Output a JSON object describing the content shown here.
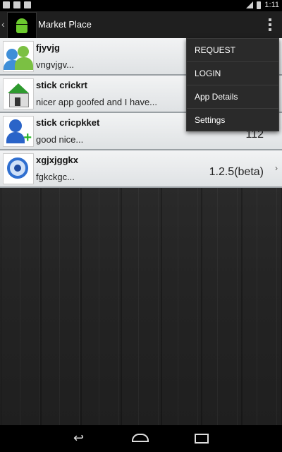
{
  "status_bar": {
    "time": "1:11"
  },
  "action_bar": {
    "title": "Market Place",
    "up_icon": "chevron-left-icon",
    "app_icon": "android-icon",
    "overflow_icon": "overflow-menu-icon"
  },
  "list": {
    "items": [
      {
        "name": "fjyvjg",
        "description": "vngvjgv...",
        "version": "",
        "icon": "users-icon"
      },
      {
        "name": "stick crickrt",
        "description": "nicer app goofed and I have...",
        "version": "",
        "icon": "house-icon"
      },
      {
        "name": "stick cricpkket",
        "description": "good nice...",
        "version": "112",
        "icon": "add-user-icon"
      },
      {
        "name": "xgjxjggkx",
        "description": "fgkckgc...",
        "version": "1.2.5(beta)",
        "icon": "sync-icon"
      }
    ]
  },
  "menu": {
    "items": [
      "REQUEST",
      "LOGIN",
      "App Details",
      "Settings"
    ]
  },
  "nav_bar": {
    "back_icon": "back-icon",
    "home_icon": "home-icon",
    "recents_icon": "recents-icon"
  }
}
